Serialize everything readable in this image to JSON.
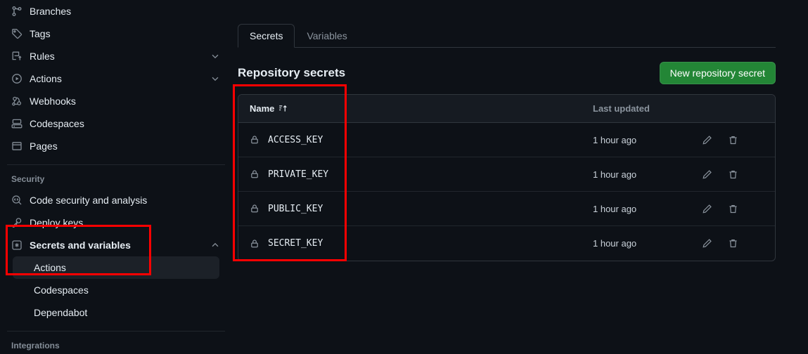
{
  "sidebar": {
    "items": [
      {
        "label": "Branches",
        "icon": "git-branch-icon",
        "chevron": false
      },
      {
        "label": "Tags",
        "icon": "tag-icon",
        "chevron": false
      },
      {
        "label": "Rules",
        "icon": "rules-icon",
        "chevron": true,
        "chevron_dir": "down"
      },
      {
        "label": "Actions",
        "icon": "play-circle-icon",
        "chevron": true,
        "chevron_dir": "down"
      },
      {
        "label": "Webhooks",
        "icon": "webhook-icon",
        "chevron": false
      },
      {
        "label": "Codespaces",
        "icon": "codespaces-icon",
        "chevron": false
      },
      {
        "label": "Pages",
        "icon": "browser-icon",
        "chevron": false
      }
    ],
    "security_heading": "Security",
    "security_items": [
      {
        "label": "Code security and analysis",
        "icon": "code-scan-icon",
        "chevron": false
      },
      {
        "label": "Deploy keys",
        "icon": "key-icon",
        "chevron": false
      },
      {
        "label": "Secrets and variables",
        "icon": "asterisk-square-icon",
        "chevron": true,
        "chevron_dir": "up",
        "bold": true
      }
    ],
    "secrets_subitems": [
      {
        "label": "Actions",
        "selected": true
      },
      {
        "label": "Codespaces",
        "selected": false
      },
      {
        "label": "Dependabot",
        "selected": false
      }
    ],
    "integrations_heading": "Integrations"
  },
  "main": {
    "tabs": [
      {
        "label": "Secrets",
        "active": true
      },
      {
        "label": "Variables",
        "active": false
      }
    ],
    "page_title": "Repository secrets",
    "new_secret_button": "New repository secret",
    "table": {
      "columns": {
        "name": "Name",
        "sort_icon": "sort-ascending-icon",
        "last_updated": "Last updated"
      },
      "rows": [
        {
          "icon": "lock-icon",
          "name": "ACCESS_KEY",
          "last_updated": "1 hour ago",
          "edit_icon": "pencil-icon",
          "delete_icon": "trash-icon"
        },
        {
          "icon": "lock-icon",
          "name": "PRIVATE_KEY",
          "last_updated": "1 hour ago",
          "edit_icon": "pencil-icon",
          "delete_icon": "trash-icon"
        },
        {
          "icon": "lock-icon",
          "name": "PUBLIC_KEY",
          "last_updated": "1 hour ago",
          "edit_icon": "pencil-icon",
          "delete_icon": "trash-icon"
        },
        {
          "icon": "lock-icon",
          "name": "SECRET_KEY",
          "last_updated": "1 hour ago",
          "edit_icon": "pencil-icon",
          "delete_icon": "trash-icon"
        }
      ]
    }
  },
  "colors": {
    "page_background": "#0d1117",
    "surface": "#161b22",
    "border": "#30363d",
    "text_primary": "#e6edf3",
    "text_muted": "#8b949e",
    "accent_green": "#238636",
    "selected_accent": "#f78166",
    "annotation_red": "#ff0000"
  },
  "annotations": [
    {
      "name": "sidebar-secrets-highlight"
    },
    {
      "name": "table-name-column-highlight"
    }
  ]
}
